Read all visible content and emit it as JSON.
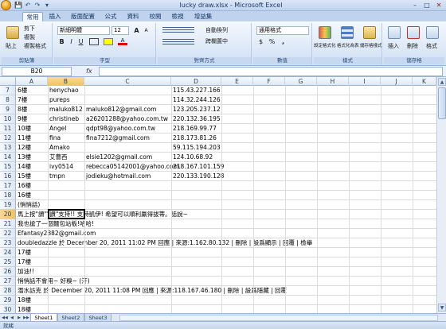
{
  "window": {
    "title": "lucky draw.xlsx - Microsoft Excel",
    "min": "–",
    "max": "□",
    "close": "✕"
  },
  "quick_access": [
    "💾",
    "↶",
    "↷",
    "▾"
  ],
  "tabs": [
    "常用",
    "插入",
    "版面配置",
    "公式",
    "資料",
    "校閱",
    "檢視",
    "增益集"
  ],
  "ribbon": {
    "clipboard": {
      "paste": "貼上",
      "cut": "剪下",
      "copy": "複製",
      "format_painter": "複製格式",
      "label": "剪貼簿"
    },
    "font": {
      "name": "新細明體",
      "size": "12",
      "grow": "A",
      "shrink": "A",
      "bold": "B",
      "italic": "I",
      "underline": "U",
      "label": "字型"
    },
    "alignment": {
      "wrap": "自動換列",
      "merge": "跨欄置中",
      "label": "對齊方式"
    },
    "number": {
      "format": "通用格式",
      "currency": "$",
      "percent": "%",
      "comma": ",",
      "label": "數值"
    },
    "styles": {
      "conditional": "設定格式化的條件",
      "table": "格式化為表格",
      "cell": "儲存格樣式",
      "label": "樣式"
    },
    "cells": {
      "insert": "插入",
      "delete": "刪除",
      "format": "格式",
      "label": "儲存格"
    }
  },
  "formula_bar": {
    "name_box": "B20",
    "fx": "fx",
    "formula": ""
  },
  "columns": [
    "A",
    "B",
    "C",
    "D",
    "E",
    "F",
    "G",
    "H",
    "I",
    "J",
    "K"
  ],
  "selected_column": "B",
  "selected_row": "20",
  "rows": [
    {
      "n": "7",
      "a": "6樓",
      "b": "henychao",
      "c": "",
      "d": "115.43.227.166"
    },
    {
      "n": "8",
      "a": "7樓",
      "b": "pureps",
      "c": "",
      "d": "114.32.244.126"
    },
    {
      "n": "9",
      "a": "8樓",
      "b": "maluko812",
      "c": "maluko812@gmail.com",
      "d": "123.205.237.12"
    },
    {
      "n": "10",
      "a": "9樓",
      "b": "christineb",
      "c": "a26201288@yahoo.com.tw",
      "d": "220.132.36.195"
    },
    {
      "n": "11",
      "a": "10樓",
      "b": "Angel",
      "c": "qdpt98@yahoo.com.tw",
      "d": "218.169.99.77"
    },
    {
      "n": "12",
      "a": "11樓",
      "b": "fina",
      "c": "fina7212@gmail.com",
      "d": "218.173.81.26"
    },
    {
      "n": "13",
      "a": "12樓",
      "b": "Amako",
      "c": "",
      "d": "59.115.194.203"
    },
    {
      "n": "14",
      "a": "13樓",
      "b": "艾曹西",
      "c": "elsie1202@gmail.com",
      "d": "124.10.68.92"
    },
    {
      "n": "15",
      "a": "14樓",
      "b": "ivy0514",
      "c": "rebecca05142001@yahoo.com.",
      "d": "218.167.101.159"
    },
    {
      "n": "16",
      "a": "15樓",
      "b": "tmpn",
      "c": "jodieku@hotmail.com",
      "d": "220.133.190.128"
    },
    {
      "n": "17",
      "a": "16樓",
      "b": "",
      "c": "",
      "d": ""
    },
    {
      "n": "18",
      "a": "16樓",
      "b": "",
      "c": "",
      "d": ""
    },
    {
      "n": "19",
      "a": "(悄悄話)",
      "b": "",
      "c": "",
      "d": ""
    },
    {
      "n": "20",
      "a": "馬上按\"讚\"\"讚\"支持!! 支持凱伊! 希望可以順利贏得拔蒂。話說~",
      "b": "",
      "c": "",
      "d": ""
    },
    {
      "n": "21",
      "a": "我也搶了一個麵包站板!哈哈!",
      "b": "",
      "c": "",
      "d": ""
    },
    {
      "n": "22",
      "a": "Efantasy2882@gmail.com",
      "b": "",
      "c": "",
      "d": ""
    },
    {
      "n": "23",
      "a": "doubledazzle 於 December 20, 2011 11:02 PM 回應 | 來源:1.162.80.132 | 刪除 | 設爲顯示 | 回覆 | 檢舉",
      "b": "",
      "c": "",
      "d": ""
    },
    {
      "n": "24",
      "a": "17樓",
      "b": "",
      "c": "",
      "d": ""
    },
    {
      "n": "25",
      "a": "17樓",
      "b": "",
      "c": "",
      "d": ""
    },
    {
      "n": "26",
      "a": "加油!!",
      "b": "",
      "c": "",
      "d": ""
    },
    {
      "n": "27",
      "a": "悄悄話不會用~ 好糗~ (汗)",
      "b": "",
      "c": "",
      "d": ""
    },
    {
      "n": "28",
      "a": "潛水訪克 於 December 20, 2011 11:08 PM 回應 | 來源:118.167.46.180 | 刪除 | 設爲隱藏 | 回覆",
      "b": "",
      "c": "",
      "d": ""
    },
    {
      "n": "29",
      "a": "18樓",
      "b": "",
      "c": "",
      "d": ""
    },
    {
      "n": "30",
      "a": "18樓",
      "b": "",
      "c": "",
      "d": ""
    }
  ],
  "sheets": [
    "Sheet1",
    "Sheet2",
    "Sheet3"
  ],
  "sheet_nav": [
    "◀◀",
    "◀",
    "▶",
    "▶▶"
  ],
  "status": "就緒"
}
